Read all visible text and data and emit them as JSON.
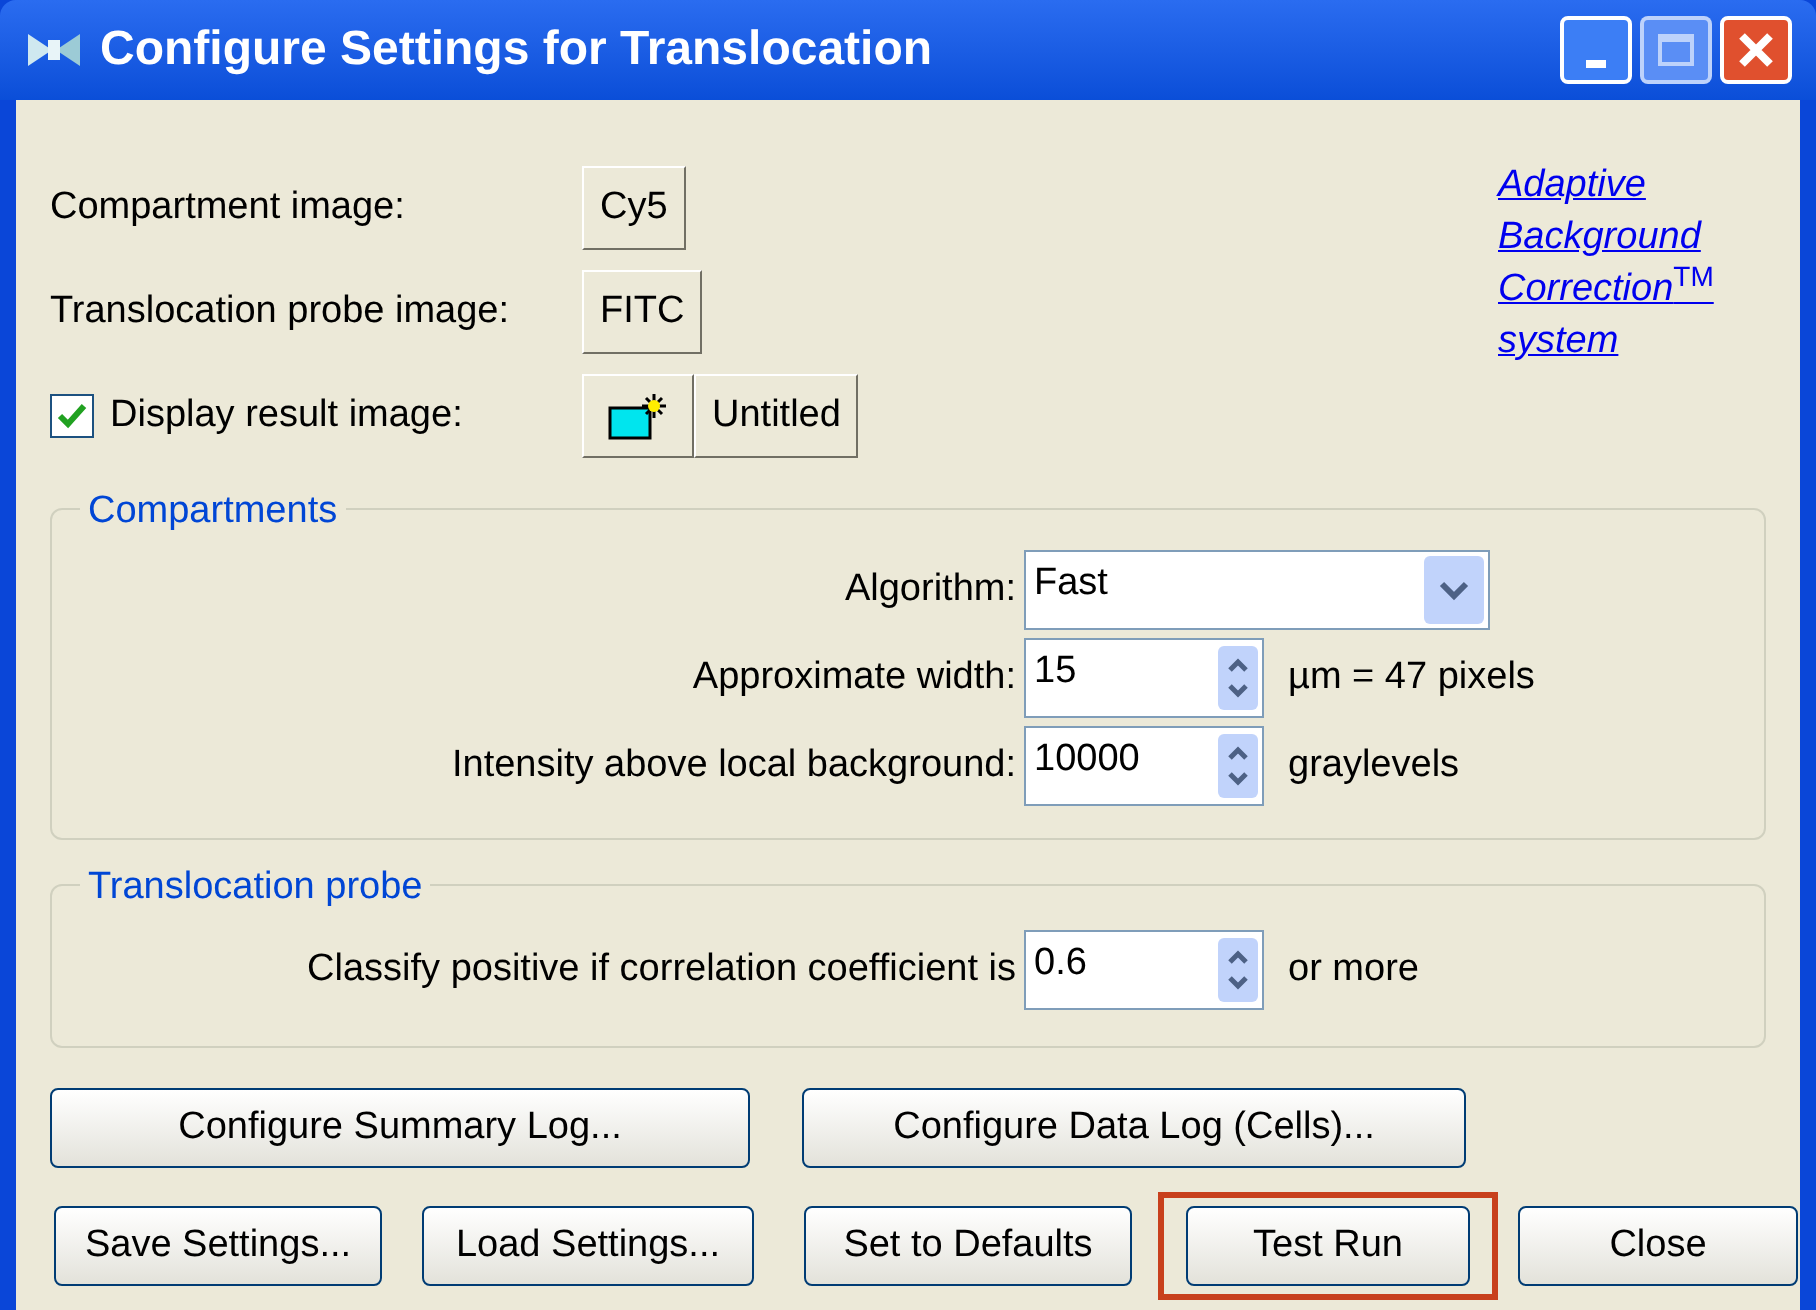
{
  "window": {
    "title": "Configure Settings for Translocation"
  },
  "sources": [
    {
      "label": "Compartment image:",
      "button": "Cy5"
    },
    {
      "label": "Translocation probe image:",
      "button": "FITC"
    }
  ],
  "display_result": {
    "label": "Display result image:",
    "checked": true,
    "button": "Untitled"
  },
  "link": {
    "lines": [
      "Adaptive",
      "Background",
      "Correction",
      "system"
    ],
    "mark": "TM"
  },
  "compartments": {
    "title": "Compartments",
    "fields": [
      {
        "kind": "dropdown",
        "label": "Algorithm:",
        "value": "Fast"
      },
      {
        "kind": "spin",
        "label": "Approximate width:",
        "value": "15",
        "unit": "µm = 47 pixels"
      },
      {
        "kind": "spin",
        "label": "Intensity above local background:",
        "value": "10000",
        "unit": "graylevels"
      }
    ]
  },
  "translocation_probe": {
    "title": "Translocation probe",
    "label": "Classify positive if correlation coefficient is",
    "value": "0.6",
    "unit": "or more"
  },
  "log_buttons": [
    "Configure Summary Log...",
    "Configure Data Log (Cells)..."
  ],
  "buttons": [
    {
      "label": "Save Settings...",
      "highlighted": false
    },
    {
      "label": "Load Settings...",
      "highlighted": false
    },
    {
      "label": "Set to Defaults",
      "highlighted": false
    },
    {
      "label": "Test Run",
      "highlighted": true
    },
    {
      "label": "Close",
      "highlighted": false
    }
  ]
}
